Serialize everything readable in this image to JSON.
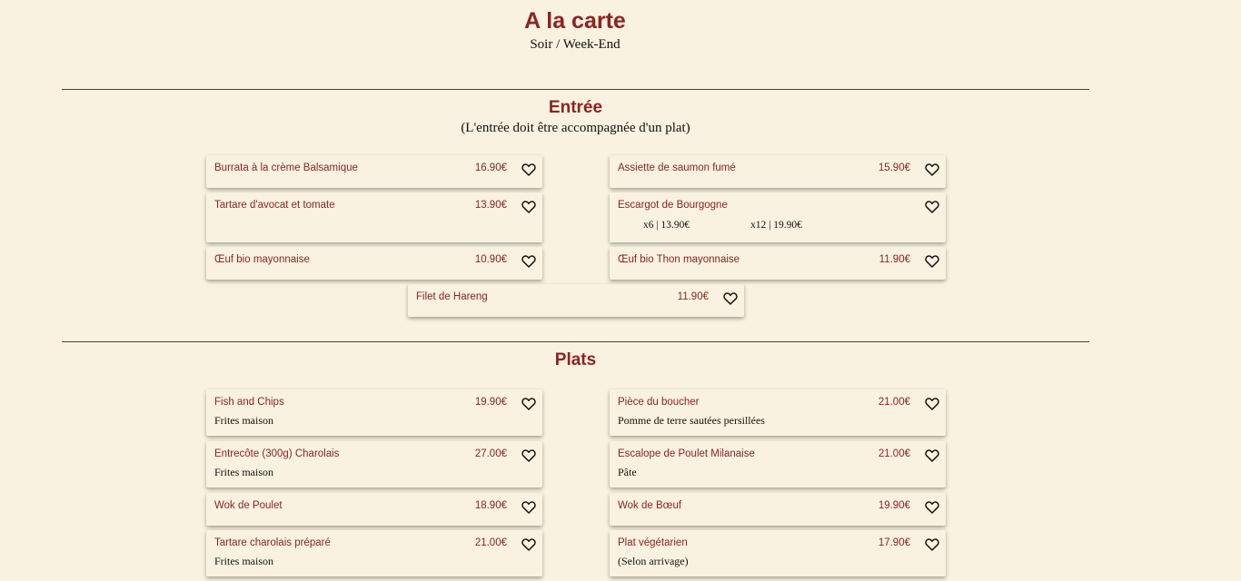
{
  "header": {
    "title": "A la carte",
    "subtitle": "Soir / Week-End"
  },
  "entree": {
    "title": "Entrée",
    "note": "(L'entrée doit être accompagnée d'un plat)",
    "items": [
      {
        "name": "Burrata à la crème Balsamique",
        "price": "16.90€"
      },
      {
        "name": "Assiette de saumon fumé",
        "price": "15.90€"
      },
      {
        "name": "Tartare d'avocat et tomate",
        "price": "13.90€"
      },
      {
        "name": "Escargot de Bourgogne",
        "price": "",
        "variants": [
          "x6 | 13.90€",
          "x12 | 19.90€"
        ]
      },
      {
        "name": "Œuf bio mayonnaise",
        "price": "10.90€"
      },
      {
        "name": "Œuf bio Thon mayonnaise",
        "price": "11.90€"
      },
      {
        "name": "Filet de Hareng",
        "price": "11.90€"
      }
    ]
  },
  "plats": {
    "title": "Plats",
    "items": [
      {
        "name": "Fish and Chips",
        "price": "19.90€",
        "desc": "Frites maison"
      },
      {
        "name": "Pièce du boucher",
        "price": "21.00€",
        "desc": "Pomme de terre sautées persillées"
      },
      {
        "name": "Entrecôte (300g) Charolais",
        "price": "27.00€",
        "desc": "Frites maison"
      },
      {
        "name": "Escalope de Poulet Milanaise",
        "price": "21.00€",
        "desc": "Pâte"
      },
      {
        "name": "Wok de Poulet",
        "price": "18.90€",
        "desc": ""
      },
      {
        "name": "Wok de Bœuf",
        "price": "19.90€",
        "desc": ""
      },
      {
        "name": "Tartare charolais préparé",
        "price": "21.00€",
        "desc": "Frites maison"
      },
      {
        "name": "Plat végétarien",
        "price": "17.90€",
        "desc": "(Selon arrivage)"
      }
    ]
  },
  "icons": {
    "favorite": "heart-icon"
  },
  "colors": {
    "background": "#f9f2e0",
    "accent": "#8b2420",
    "text": "#111111"
  }
}
